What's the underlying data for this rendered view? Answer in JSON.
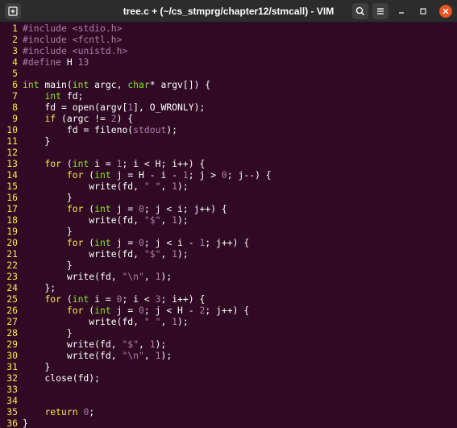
{
  "window": {
    "title": "tree.c + (~/cs_stmprg/chapter12/stmcall) - VIM"
  },
  "icons": {
    "new_tab": "new-tab-icon",
    "search": "search-icon",
    "menu": "hamburger-menu-icon",
    "minimize": "minimize-icon",
    "maximize": "maximize-icon",
    "close": "close-icon"
  },
  "colors": {
    "background": "#300a24",
    "line_number": "#fce94f",
    "preprocessor": "#ad7fa8",
    "string": "#ad7fa8",
    "number": "#ad7fa8",
    "type": "#8ae234",
    "keyword": "#fce94f",
    "text": "#ffffff",
    "close_button": "#e95420"
  },
  "editor": {
    "lines": [
      {
        "n": "1",
        "tokens": [
          {
            "t": "pre",
            "v": "#include"
          },
          {
            "t": "plain",
            "v": " "
          },
          {
            "t": "str",
            "v": "<stdio.h>"
          }
        ]
      },
      {
        "n": "2",
        "tokens": [
          {
            "t": "pre",
            "v": "#include"
          },
          {
            "t": "plain",
            "v": " "
          },
          {
            "t": "str",
            "v": "<fcntl.h>"
          }
        ]
      },
      {
        "n": "3",
        "tokens": [
          {
            "t": "pre",
            "v": "#include"
          },
          {
            "t": "plain",
            "v": " "
          },
          {
            "t": "str",
            "v": "<unistd.h>"
          }
        ]
      },
      {
        "n": "4",
        "tokens": [
          {
            "t": "pre",
            "v": "#define"
          },
          {
            "t": "plain",
            "v": " H "
          },
          {
            "t": "num",
            "v": "13"
          }
        ]
      },
      {
        "n": "5",
        "tokens": []
      },
      {
        "n": "6",
        "tokens": [
          {
            "t": "type",
            "v": "int"
          },
          {
            "t": "plain",
            "v": " main("
          },
          {
            "t": "type",
            "v": "int"
          },
          {
            "t": "plain",
            "v": " argc, "
          },
          {
            "t": "type",
            "v": "char"
          },
          {
            "t": "plain",
            "v": "* argv[]) {"
          }
        ]
      },
      {
        "n": "7",
        "tokens": [
          {
            "t": "plain",
            "v": "    "
          },
          {
            "t": "type",
            "v": "int"
          },
          {
            "t": "plain",
            "v": " fd;"
          }
        ]
      },
      {
        "n": "8",
        "tokens": [
          {
            "t": "plain",
            "v": "    fd = open(argv["
          },
          {
            "t": "num",
            "v": "1"
          },
          {
            "t": "plain",
            "v": "], O_WRONLY);"
          }
        ]
      },
      {
        "n": "9",
        "tokens": [
          {
            "t": "plain",
            "v": "    "
          },
          {
            "t": "kw",
            "v": "if"
          },
          {
            "t": "plain",
            "v": " (argc != "
          },
          {
            "t": "num",
            "v": "2"
          },
          {
            "t": "plain",
            "v": ") {"
          }
        ]
      },
      {
        "n": "10",
        "tokens": [
          {
            "t": "plain",
            "v": "        fd = fileno("
          },
          {
            "t": "spec",
            "v": "stdout"
          },
          {
            "t": "plain",
            "v": ");"
          }
        ]
      },
      {
        "n": "11",
        "tokens": [
          {
            "t": "plain",
            "v": "    }"
          }
        ]
      },
      {
        "n": "12",
        "tokens": []
      },
      {
        "n": "13",
        "tokens": [
          {
            "t": "plain",
            "v": "    "
          },
          {
            "t": "kw",
            "v": "for"
          },
          {
            "t": "plain",
            "v": " ("
          },
          {
            "t": "type",
            "v": "int"
          },
          {
            "t": "plain",
            "v": " i = "
          },
          {
            "t": "num",
            "v": "1"
          },
          {
            "t": "plain",
            "v": "; i < H; i++) {"
          }
        ]
      },
      {
        "n": "14",
        "tokens": [
          {
            "t": "plain",
            "v": "        "
          },
          {
            "t": "kw",
            "v": "for"
          },
          {
            "t": "plain",
            "v": " ("
          },
          {
            "t": "type",
            "v": "int"
          },
          {
            "t": "plain",
            "v": " j = H - i - "
          },
          {
            "t": "num",
            "v": "1"
          },
          {
            "t": "plain",
            "v": "; j > "
          },
          {
            "t": "num",
            "v": "0"
          },
          {
            "t": "plain",
            "v": "; j--) {"
          }
        ]
      },
      {
        "n": "15",
        "tokens": [
          {
            "t": "plain",
            "v": "            write(fd, "
          },
          {
            "t": "str",
            "v": "\" \""
          },
          {
            "t": "plain",
            "v": ", "
          },
          {
            "t": "num",
            "v": "1"
          },
          {
            "t": "plain",
            "v": ");"
          }
        ]
      },
      {
        "n": "16",
        "tokens": [
          {
            "t": "plain",
            "v": "        }"
          }
        ]
      },
      {
        "n": "17",
        "tokens": [
          {
            "t": "plain",
            "v": "        "
          },
          {
            "t": "kw",
            "v": "for"
          },
          {
            "t": "plain",
            "v": " ("
          },
          {
            "t": "type",
            "v": "int"
          },
          {
            "t": "plain",
            "v": " j = "
          },
          {
            "t": "num",
            "v": "0"
          },
          {
            "t": "plain",
            "v": "; j < i; j++) {"
          }
        ]
      },
      {
        "n": "18",
        "tokens": [
          {
            "t": "plain",
            "v": "            write(fd, "
          },
          {
            "t": "str",
            "v": "\"$\""
          },
          {
            "t": "plain",
            "v": ", "
          },
          {
            "t": "num",
            "v": "1"
          },
          {
            "t": "plain",
            "v": ");"
          }
        ]
      },
      {
        "n": "19",
        "tokens": [
          {
            "t": "plain",
            "v": "        }"
          }
        ]
      },
      {
        "n": "20",
        "tokens": [
          {
            "t": "plain",
            "v": "        "
          },
          {
            "t": "kw",
            "v": "for"
          },
          {
            "t": "plain",
            "v": " ("
          },
          {
            "t": "type",
            "v": "int"
          },
          {
            "t": "plain",
            "v": " j = "
          },
          {
            "t": "num",
            "v": "0"
          },
          {
            "t": "plain",
            "v": "; j < i - "
          },
          {
            "t": "num",
            "v": "1"
          },
          {
            "t": "plain",
            "v": "; j++) {"
          }
        ]
      },
      {
        "n": "21",
        "tokens": [
          {
            "t": "plain",
            "v": "            write(fd, "
          },
          {
            "t": "str",
            "v": "\"$\""
          },
          {
            "t": "plain",
            "v": ", "
          },
          {
            "t": "num",
            "v": "1"
          },
          {
            "t": "plain",
            "v": ");"
          }
        ]
      },
      {
        "n": "22",
        "tokens": [
          {
            "t": "plain",
            "v": "        }"
          }
        ]
      },
      {
        "n": "23",
        "tokens": [
          {
            "t": "plain",
            "v": "        write(fd, "
          },
          {
            "t": "str",
            "v": "\"\\n\""
          },
          {
            "t": "plain",
            "v": ", "
          },
          {
            "t": "num",
            "v": "1"
          },
          {
            "t": "plain",
            "v": ");"
          }
        ]
      },
      {
        "n": "24",
        "tokens": [
          {
            "t": "plain",
            "v": "    };"
          }
        ]
      },
      {
        "n": "25",
        "tokens": [
          {
            "t": "plain",
            "v": "    "
          },
          {
            "t": "kw",
            "v": "for"
          },
          {
            "t": "plain",
            "v": " ("
          },
          {
            "t": "type",
            "v": "int"
          },
          {
            "t": "plain",
            "v": " i = "
          },
          {
            "t": "num",
            "v": "0"
          },
          {
            "t": "plain",
            "v": "; i < "
          },
          {
            "t": "num",
            "v": "3"
          },
          {
            "t": "plain",
            "v": "; i++) {"
          }
        ]
      },
      {
        "n": "26",
        "tokens": [
          {
            "t": "plain",
            "v": "        "
          },
          {
            "t": "kw",
            "v": "for"
          },
          {
            "t": "plain",
            "v": " ("
          },
          {
            "t": "type",
            "v": "int"
          },
          {
            "t": "plain",
            "v": " j = "
          },
          {
            "t": "num",
            "v": "0"
          },
          {
            "t": "plain",
            "v": "; j < H - "
          },
          {
            "t": "num",
            "v": "2"
          },
          {
            "t": "plain",
            "v": "; j++) {"
          }
        ]
      },
      {
        "n": "27",
        "tokens": [
          {
            "t": "plain",
            "v": "            write(fd, "
          },
          {
            "t": "str",
            "v": "\" \""
          },
          {
            "t": "plain",
            "v": ", "
          },
          {
            "t": "num",
            "v": "1"
          },
          {
            "t": "plain",
            "v": ");"
          }
        ]
      },
      {
        "n": "28",
        "tokens": [
          {
            "t": "plain",
            "v": "        }"
          }
        ]
      },
      {
        "n": "29",
        "tokens": [
          {
            "t": "plain",
            "v": "        write(fd, "
          },
          {
            "t": "str",
            "v": "\"$\""
          },
          {
            "t": "plain",
            "v": ", "
          },
          {
            "t": "num",
            "v": "1"
          },
          {
            "t": "plain",
            "v": ");"
          }
        ]
      },
      {
        "n": "30",
        "tokens": [
          {
            "t": "plain",
            "v": "        write(fd, "
          },
          {
            "t": "str",
            "v": "\"\\n\""
          },
          {
            "t": "plain",
            "v": ", "
          },
          {
            "t": "num",
            "v": "1"
          },
          {
            "t": "plain",
            "v": ");"
          }
        ]
      },
      {
        "n": "31",
        "tokens": [
          {
            "t": "plain",
            "v": "    }"
          }
        ]
      },
      {
        "n": "32",
        "tokens": [
          {
            "t": "plain",
            "v": "    close(fd);"
          }
        ]
      },
      {
        "n": "33",
        "tokens": []
      },
      {
        "n": "34",
        "tokens": []
      },
      {
        "n": "35",
        "tokens": [
          {
            "t": "plain",
            "v": "    "
          },
          {
            "t": "kw",
            "v": "return"
          },
          {
            "t": "plain",
            "v": " "
          },
          {
            "t": "num",
            "v": "0"
          },
          {
            "t": "plain",
            "v": ";"
          }
        ]
      },
      {
        "n": "36",
        "tokens": [
          {
            "t": "plain",
            "v": "}"
          }
        ]
      }
    ]
  }
}
